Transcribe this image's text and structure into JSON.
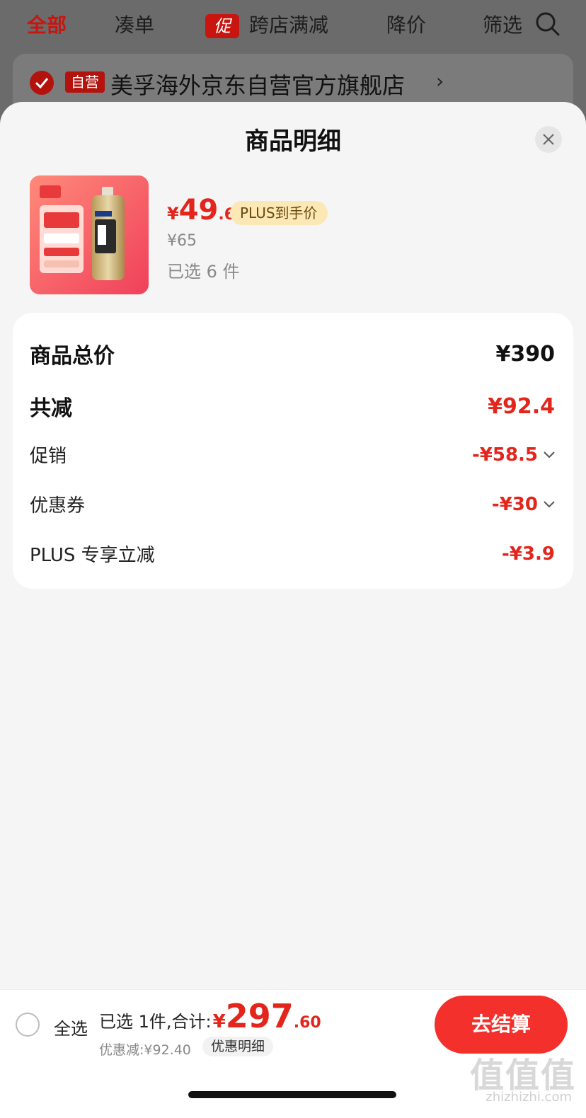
{
  "topbar": {
    "tabs": [
      {
        "label": "全部",
        "active": true
      },
      {
        "label": "凑单",
        "active": false
      },
      {
        "label": "跨店满减",
        "active": false,
        "badge": "促"
      },
      {
        "label": "降价",
        "active": false
      },
      {
        "label": "筛选",
        "active": false
      }
    ]
  },
  "store": {
    "tag": "自营",
    "name": "美孚海外京东自营官方旗舰店",
    "arrow": "›"
  },
  "sheet": {
    "title": "商品明细",
    "product": {
      "price_yen": "¥",
      "price_int": "49",
      "price_dec": ".6",
      "plus_badge": "PLUS到手价",
      "original_price": "¥65",
      "selected": "已选 6 件"
    },
    "details": {
      "total_label": "商品总价",
      "total_value": "¥390",
      "reduce_label": "共减",
      "reduce_value": "¥92.4",
      "promo_label": "促销",
      "promo_value": "-¥58.5",
      "coupon_label": "优惠券",
      "coupon_value": "-¥30",
      "plus_label": "PLUS 专享立减",
      "plus_value": "-¥3.9"
    }
  },
  "bottom": {
    "select_all": "全选",
    "total_prefix": "已选 1件,合计:",
    "total_yen": "¥",
    "total_int": "297",
    "total_dec": ".60",
    "discount": "优惠减:¥92.40",
    "detail_link": "优惠明细",
    "checkout": "去结算"
  },
  "watermark": {
    "main": "值值值",
    "sub": "zhizhizhi.com"
  },
  "colors": {
    "accent": "#e4251c",
    "brand_dark": "#c9150f",
    "plus_badge_bg": "#fce8b5"
  }
}
